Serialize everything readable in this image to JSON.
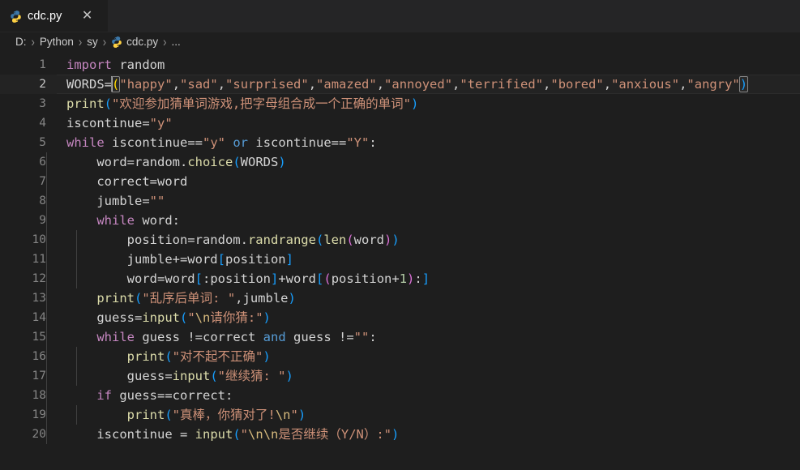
{
  "window": {
    "background": "#1e1e1e",
    "tabbar_background": "#252526"
  },
  "tab": {
    "icon": "python-file-icon",
    "label": "cdc.py",
    "close_label": "✕",
    "active": true
  },
  "breadcrumb": {
    "separator": "›",
    "items": [
      {
        "label": "D:",
        "icon": ""
      },
      {
        "label": "Python",
        "icon": ""
      },
      {
        "label": "sy",
        "icon": ""
      },
      {
        "label": "cdc.py",
        "icon": "python-file-icon"
      },
      {
        "label": "...",
        "icon": ""
      }
    ]
  },
  "editor": {
    "language": "python",
    "cursor_line": 2,
    "active_line": 2,
    "total_lines": 20,
    "line_numbers": [
      "1",
      "2",
      "3",
      "4",
      "5",
      "6",
      "7",
      "8",
      "9",
      "10",
      "11",
      "12",
      "13",
      "14",
      "15",
      "16",
      "17",
      "18",
      "19",
      "20"
    ],
    "colors": {
      "keyword": "#c586c0",
      "operator_keyword": "#569cd6",
      "string": "#ce9178",
      "function": "#dcdcaa",
      "variable": "#9cdcfe",
      "plain": "#d4d4d4",
      "number": "#b5cea8",
      "escape": "#d7ba7d",
      "line_number": "#858585",
      "active_line_number": "#c6c6c6",
      "indent_guide": "#404040"
    },
    "source_lines": [
      "import random",
      "WORDS=(\"happy\",\"sad\",\"surprised\",\"amazed\",\"annoyed\",\"terrified\",\"bored\",\"anxious\",\"angry\")",
      "print(\"欢迎参加猜单词游戏,把字母组合成一个正确的单词\")",
      "iscontinue=\"y\"",
      "while iscontinue==\"y\" or iscontinue==\"Y\":",
      "    word=random.choice(WORDS)",
      "    correct=word",
      "    jumble=\"\"",
      "    while word:",
      "        position=random.randrange(len(word))",
      "        jumble+=word[position]",
      "        word=word[:position]+word[(position+1):]",
      "    print(\"乱序后单词: \",jumble)",
      "    guess=input(\"\\n请你猜:\")",
      "    while guess !=correct and guess !=\"\":",
      "        print(\"对不起不正确\")",
      "        guess=input(\"继续猜: \")",
      "    if guess==correct:",
      "        print(\"真棒，你猜对了!\\n\")",
      "    iscontinue = input(\"\\n\\n是否继续（Y/N）:\")"
    ]
  }
}
